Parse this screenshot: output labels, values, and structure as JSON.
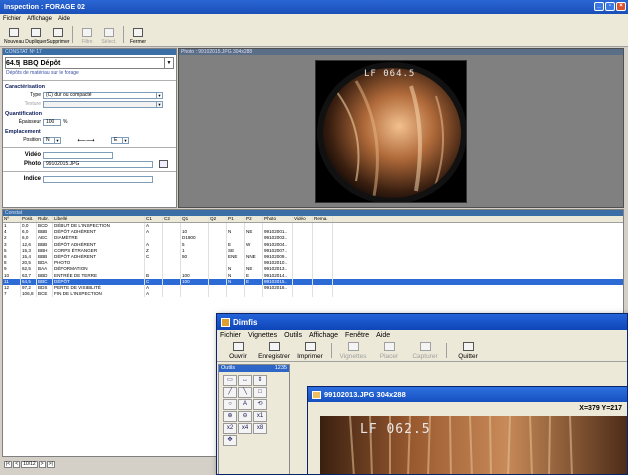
{
  "main_window": {
    "title": "Inspection : FORAGE 02",
    "menu": [
      "Fichier",
      "Affichage",
      "Aide"
    ],
    "toolbar": [
      {
        "label": "Nouveau",
        "icon": "new-doc-icon",
        "enabled": true
      },
      {
        "label": "Dupliquer",
        "icon": "duplicate-icon",
        "enabled": true
      },
      {
        "label": "Supprimer",
        "icon": "delete-icon",
        "enabled": true
      },
      {
        "label": "Filtre",
        "icon": "filter-icon",
        "enabled": false
      },
      {
        "label": "Sélect.",
        "icon": "select-icon",
        "enabled": false
      },
      {
        "label": "Fermer",
        "icon": "close-door-icon",
        "enabled": true
      }
    ],
    "left_panel": {
      "header": "CONSTAT Nº 17",
      "code": "64.5",
      "code_name": "BBQ Dépôt",
      "description": "Dépôts de matériau sur le forage",
      "characterisation_title": "Caractérisation",
      "type_label": "Type",
      "type_value": "(C) dur ou compacté",
      "texture_label": "Texture",
      "texture_value": "",
      "quantification_title": "Quantification",
      "epaisseur_label": "Épaisseur",
      "epaisseur_value": "100",
      "epaisseur_unit": "%",
      "emplacement_title": "Emplacement",
      "position_label": "Position",
      "position_from": "N",
      "position_arrow": "⟵⟶",
      "position_to": "E",
      "video_label": "Vidéo",
      "video_value": "",
      "photo_label": "Photo",
      "photo_value": "99102015.JPG",
      "indice_label": "Indice"
    },
    "photo_panel": {
      "header": "Photo : 99102015.JPG  304x288",
      "overlay_text": "LF 064.5"
    },
    "table": {
      "header": "Constat",
      "columns": [
        "Nº",
        "Posit.",
        "Rubr.",
        "Libellé",
        "C1",
        "C2",
        "Q1",
        "Q2",
        "P1",
        "P2",
        "Photo",
        "Vidéo",
        "Rema."
      ],
      "rows": [
        [
          "1",
          "0,0",
          "BCD",
          "DÉBUT DE L'INSPECTION",
          "A",
          "",
          "",
          "",
          "",
          "",
          "",
          "",
          ""
        ],
        [
          "4",
          "6,0",
          "BBB",
          "DÉPÔT ADHÉRENT",
          "A",
          "",
          "10",
          "",
          "N",
          "NE",
          "99102001..",
          "",
          ""
        ],
        [
          "2",
          "6,0",
          "AEC",
          "DIAMÈTRE",
          "",
          "",
          "D1900",
          "",
          "",
          "",
          "99102003..",
          "",
          ""
        ],
        [
          "3",
          "12,6",
          "BBB",
          "DÉPÔT ADHÉRENT",
          "A",
          "",
          "5",
          "",
          "E",
          "W",
          "99102004..",
          "",
          ""
        ],
        [
          "5",
          "15,3",
          "BBH",
          "CORPS ÉTRANGER",
          "Z",
          "",
          "1",
          "",
          "SE",
          "",
          "99102007..",
          "",
          ""
        ],
        [
          "6",
          "15,4",
          "BBB",
          "DÉPÔT ADHÉRENT",
          "C",
          "",
          "50",
          "",
          "ENE",
          "NNE",
          "99102009..",
          "",
          ""
        ],
        [
          "8",
          "20,5",
          "BDA",
          "PHOTO",
          "",
          "",
          "",
          "",
          "",
          "",
          "99102010..",
          "",
          ""
        ],
        [
          "9",
          "62,5",
          "BAA",
          "DÉFORMATION",
          "",
          "",
          "",
          "",
          "N",
          "NE",
          "99102013..",
          "",
          ""
        ],
        [
          "10",
          "63,7",
          "BBD",
          "ENTRÉE DE TERRE",
          "B",
          "",
          "100",
          "",
          "N",
          "E",
          "99102014..",
          "",
          ""
        ],
        [
          "11",
          "64,5",
          "BBC",
          "DÉPÔT",
          "C",
          "",
          "100",
          "",
          "N",
          "E",
          "99102015..",
          "",
          ""
        ],
        [
          "12",
          "97,2",
          "BDS",
          "PERTE DE VISIBILITÉ",
          "A",
          "",
          "",
          "",
          "",
          "",
          "99102016..",
          "",
          ""
        ],
        [
          "7",
          "106,8",
          "BCE",
          "FIN DE L'INSPECTION",
          "A",
          "",
          "",
          "",
          "",
          "",
          "",
          "",
          ""
        ]
      ],
      "selected_index": 9
    },
    "pager": [
      "|<",
      "<",
      "10/12",
      ">",
      ">|"
    ]
  },
  "second_window": {
    "title": "Dimfis",
    "menu": [
      "Fichier",
      "Vignettes",
      "Outils",
      "Affichage",
      "Fenêtre",
      "Aide"
    ],
    "toolbar": [
      {
        "label": "Ouvrir",
        "icon": "open-folder-icon",
        "enabled": true
      },
      {
        "label": "Enregistrer",
        "icon": "save-icon",
        "enabled": true
      },
      {
        "label": "Imprimer",
        "icon": "print-icon",
        "enabled": true
      },
      {
        "label": "Vignettes",
        "icon": "thumbnails-icon",
        "enabled": false
      },
      {
        "label": "Placer",
        "icon": "place-icon",
        "enabled": false
      },
      {
        "label": "Capturer",
        "icon": "capture-icon",
        "enabled": false
      },
      {
        "label": "Quitter",
        "icon": "quit-icon",
        "enabled": true
      }
    ],
    "tools_panel": {
      "title": "Outils",
      "count": "1235",
      "tools": [
        {
          "glyph": "▭",
          "icon": "rectangle-select-icon"
        },
        {
          "glyph": "↔",
          "icon": "horizontal-measure-icon"
        },
        {
          "glyph": "⇕",
          "icon": "vertical-measure-icon"
        },
        {
          "glyph": "╱",
          "icon": "line-icon"
        },
        {
          "glyph": "╲",
          "icon": "diagonal-line-icon"
        },
        {
          "glyph": "□",
          "icon": "square-icon"
        },
        {
          "glyph": "○",
          "icon": "ellipse-icon"
        },
        {
          "glyph": "A",
          "icon": "text-icon"
        },
        {
          "glyph": "⟲",
          "icon": "rotate-icon"
        },
        {
          "glyph": "⊕",
          "icon": "zoom-in-icon"
        },
        {
          "glyph": "⊖",
          "icon": "zoom-out-icon"
        },
        {
          "glyph": "x1",
          "icon": "zoom-1x-icon"
        },
        {
          "glyph": "x2",
          "icon": "zoom-2x-icon"
        },
        {
          "glyph": "x4",
          "icon": "zoom-4x-icon"
        },
        {
          "glyph": "x8",
          "icon": "zoom-8x-icon"
        },
        {
          "glyph": "✥",
          "icon": "pan-icon"
        }
      ]
    },
    "image_window": {
      "title": "99102013.JPG 304x288",
      "coords": "X=379 Y=217",
      "overlay_text": "LF 062.5"
    }
  }
}
